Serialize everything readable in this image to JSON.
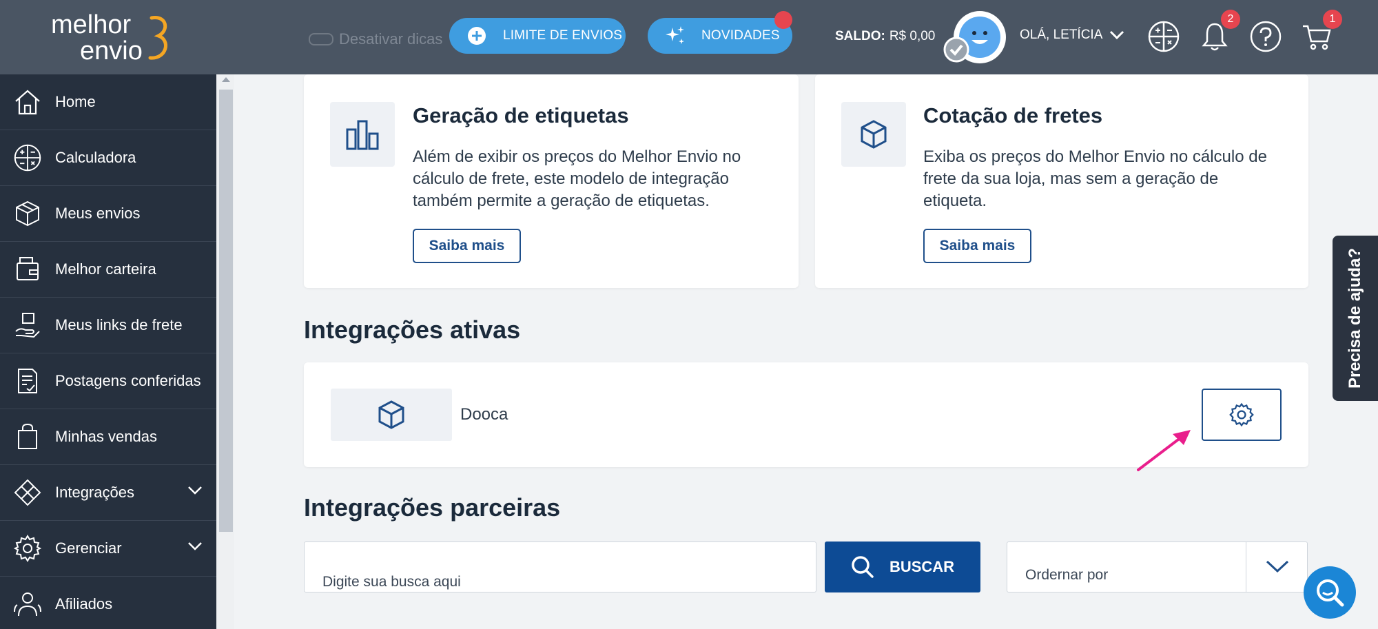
{
  "header": {
    "logo_line1": "melhor",
    "logo_line2": "envio",
    "ghost_tip": "Desativar dicas",
    "limit_button": "LIMITE DE ENVIOS",
    "news_button": "NOVIDADES",
    "saldo_label": "SALDO:",
    "saldo_value": "R$ 0,00",
    "greeting": "OLÁ, LETÍCIA",
    "notifications_count": "2",
    "cart_count": "1"
  },
  "sidebar": {
    "items": [
      {
        "label": "Home",
        "icon": "home-icon"
      },
      {
        "label": "Calculadora",
        "icon": "calculator-icon"
      },
      {
        "label": "Meus envios",
        "icon": "package-icon"
      },
      {
        "label": "Melhor carteira",
        "icon": "wallet-icon"
      },
      {
        "label": "Meus links de frete",
        "icon": "link-box-icon"
      },
      {
        "label": "Postagens conferidas",
        "icon": "document-check-icon"
      },
      {
        "label": "Minhas vendas",
        "icon": "shopping-bag-icon"
      },
      {
        "label": "Integrações",
        "icon": "puzzle-icon"
      },
      {
        "label": "Gerenciar",
        "icon": "gear-icon"
      },
      {
        "label": "Afiliados",
        "icon": "people-icon"
      }
    ]
  },
  "cards": {
    "labels": {
      "title": "Geração de etiquetas",
      "desc": "Além de exibir os preços do Melhor Envio no cálculo de frete, este modelo de integração também permite a geração de etiquetas.",
      "button": "Saiba mais"
    },
    "quote": {
      "title": "Cotação de fretes",
      "desc": "Exiba os preços do Melhor Envio no cálculo de frete da sua loja, mas sem a geração de etiqueta.",
      "button": "Saiba mais"
    }
  },
  "active_integrations": {
    "title": "Integrações ativas",
    "items": [
      {
        "name": "Dooca"
      }
    ]
  },
  "partner_integrations": {
    "title": "Integrações parceiras",
    "search_placeholder": "Digite sua busca aqui",
    "search_button": "BUSCAR",
    "order_label": "Ordernar por"
  },
  "help_tab": "Precisa de ajuda?",
  "colors": {
    "topbar": "#4a5563",
    "sidebar": "#26303e",
    "accent": "#3f9de0",
    "primary": "#0d4b95",
    "badge": "#e6454f",
    "annotation": "#e91e8c"
  }
}
